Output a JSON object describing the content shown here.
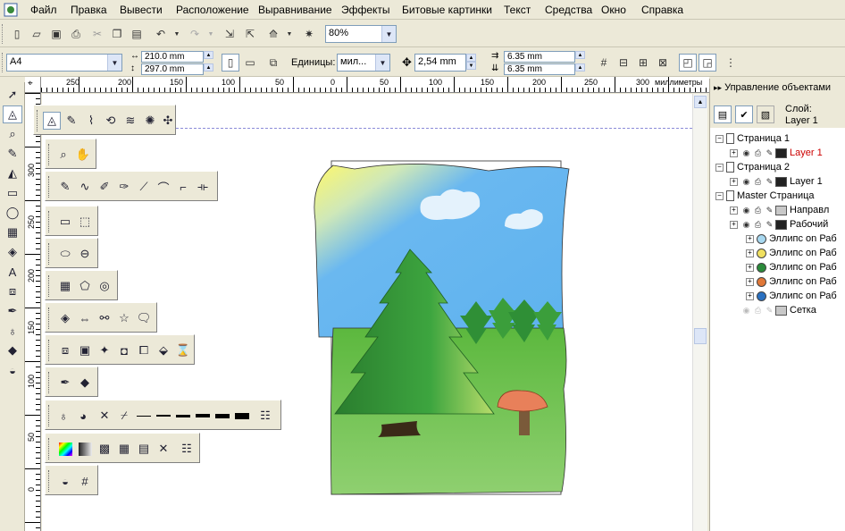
{
  "menu": [
    "Файл",
    "Правка",
    "Вывести",
    "Расположение",
    "Выравнивание",
    "Эффекты",
    "Битовые картинки",
    "Текст",
    "Средства",
    "Окно",
    "Справка"
  ],
  "toolbar": {
    "zoom": "80%"
  },
  "propbar": {
    "page_size": "A4",
    "width": "210.0 mm",
    "height": "297.0 mm",
    "units_label": "Единицы:",
    "units_value": "мил...",
    "nudge": "2,54 mm",
    "dup_x": "6.35 mm",
    "dup_y": "6.35 mm"
  },
  "hruler": {
    "ticks": [
      "250",
      "200",
      "150",
      "100",
      "50",
      "0",
      "50",
      "100",
      "150",
      "200",
      "250",
      "300"
    ],
    "unit": "миллиметры"
  },
  "vruler": {
    "ticks": [
      "300",
      "250",
      "200",
      "150",
      "100",
      "50",
      "0"
    ]
  },
  "docker": {
    "title": "Управление объектами",
    "layer_label": "Слой:",
    "layer_value": "Layer 1",
    "tree": [
      {
        "level": 0,
        "type": "page",
        "label": "Страница 1"
      },
      {
        "level": 1,
        "type": "layer",
        "label": "Layer 1",
        "active": true,
        "color": "#222222"
      },
      {
        "level": 0,
        "type": "page",
        "label": "Страница 2"
      },
      {
        "level": 1,
        "type": "layer",
        "label": "Layer 1",
        "color": "#222222"
      },
      {
        "level": 0,
        "type": "page",
        "label": "Master Страница"
      },
      {
        "level": 1,
        "type": "layer",
        "label": "Направл",
        "color": "#c8c8c8"
      },
      {
        "level": 1,
        "type": "layer",
        "label": "Рабочий",
        "color": "#222222"
      },
      {
        "level": 2,
        "type": "obj",
        "label": "Эллипс on Раб",
        "color": "#a8d8f0"
      },
      {
        "level": 2,
        "type": "obj",
        "label": "Эллипс on Раб",
        "color": "#f0e060"
      },
      {
        "level": 2,
        "type": "obj",
        "label": "Эллипс on Раб",
        "color": "#2a8a3a"
      },
      {
        "level": 2,
        "type": "obj",
        "label": "Эллипс on Раб",
        "color": "#e07838"
      },
      {
        "level": 2,
        "type": "obj",
        "label": "Эллипс on Раб",
        "color": "#2a70c0"
      },
      {
        "level": 1,
        "type": "layer",
        "label": "Сетка",
        "color": "#c8c8c8",
        "dim": true
      }
    ]
  },
  "colors": {
    "active_layer": "#cc0000",
    "sky": "#6ab8f0",
    "grass": "#6ec04a",
    "tree": "#2f8f36"
  }
}
